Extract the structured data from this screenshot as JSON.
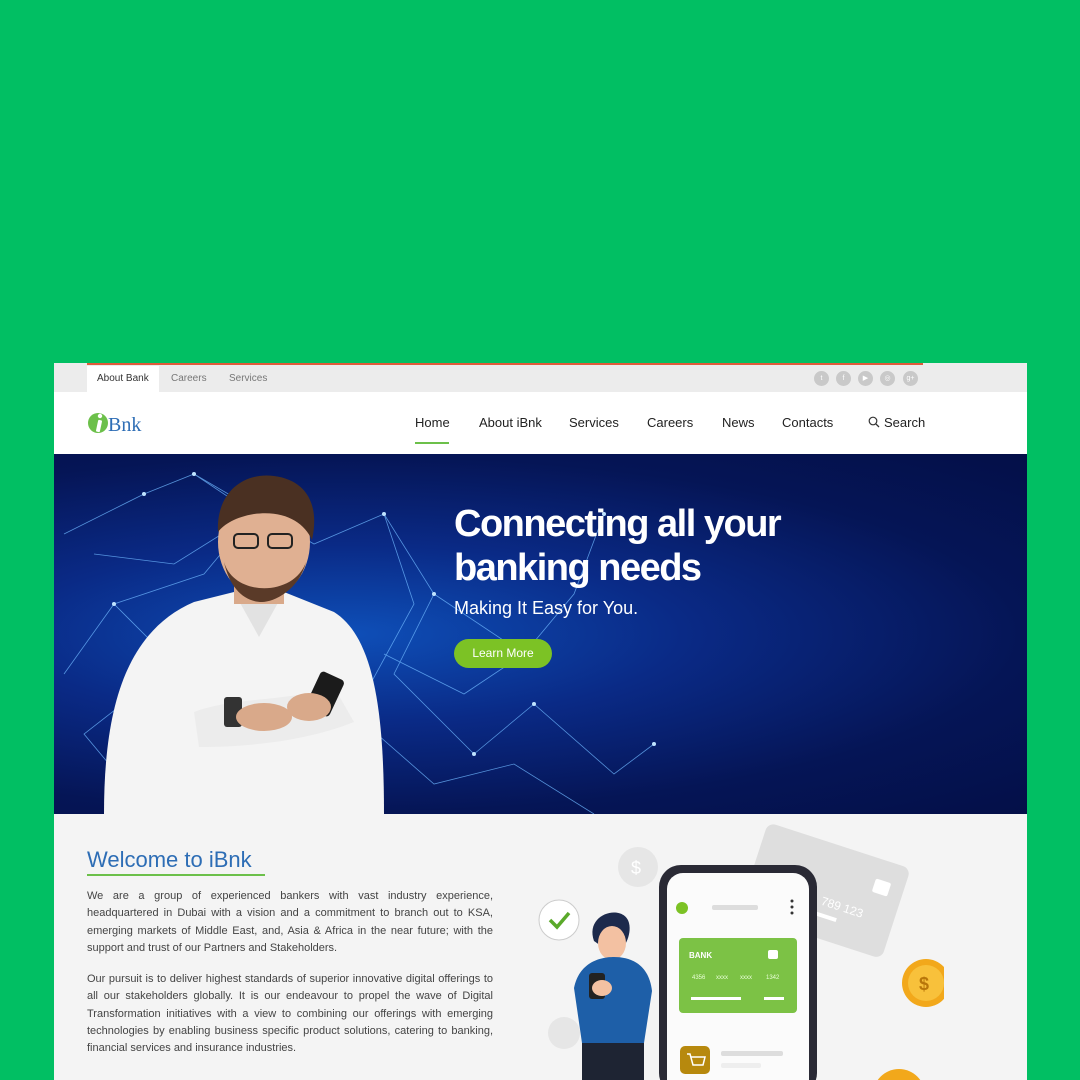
{
  "topbar": {
    "links": [
      "About Bank",
      "Careers",
      "Services"
    ],
    "social_icons": [
      "twitter-icon",
      "facebook-icon",
      "youtube-icon",
      "instagram-icon",
      "google-plus-icon"
    ]
  },
  "brand": {
    "logo_text": "Bnk"
  },
  "nav": {
    "items": [
      "Home",
      "About iBnk",
      "Services",
      "Careers",
      "News",
      "Contacts"
    ],
    "search_label": "Search",
    "active": "Home"
  },
  "hero": {
    "title": "Connecting all your banking needs",
    "subtitle": "Making It Easy for You.",
    "button": "Learn More"
  },
  "welcome": {
    "title": "Welcome to iBnk",
    "paragraphs": [
      "We are a group of experienced bankers with vast industry experience, headquartered in Dubai with a vision and a commitment to branch out to KSA, emerging markets of Middle East, and, Asia & Africa in the near future; with the support and trust of our Partners and Stakeholders.",
      "Our pursuit is to deliver highest standards of superior innovative digital offerings to all our stakeholders globally. It is our endeavour to propel the wave of Digital Transformation initiatives with a view to combining our offerings with emerging technologies by enabling business specific product solutions, catering to banking, financial services and insurance industries."
    ]
  },
  "illustration": {
    "card_label": "BANK",
    "card_number": [
      "4356",
      "xxxx",
      "xxxx",
      "1342"
    ],
    "back_card_number": "789 123",
    "coin_symbol": "$"
  },
  "colors": {
    "background": "#01bf63",
    "accent_green": "#7cc225",
    "brand_blue": "#2d6db5",
    "hero_dark": "#040f48"
  }
}
